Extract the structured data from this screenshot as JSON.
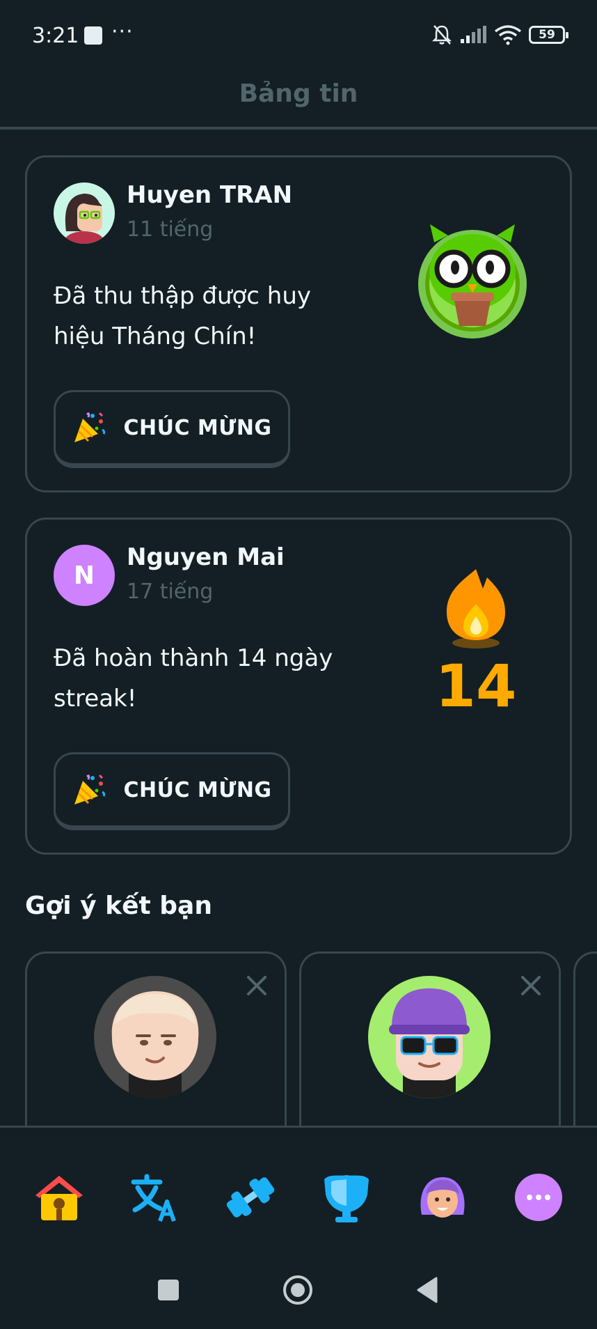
{
  "status_bar": {
    "time": "3:21",
    "dots": "···",
    "battery": "59",
    "icons": [
      "notification-square-icon",
      "bell-off-icon",
      "signal-icon",
      "wifi-icon",
      "battery-icon"
    ]
  },
  "header": {
    "title": "Bảng tin"
  },
  "feed": [
    {
      "name": "Huyen TRAN",
      "time": "11 tiếng",
      "message": "Đã thu thập được huy hiệu Tháng Chín!",
      "button": "CHÚC MỪNG",
      "art": "monthly-badge-owl-icon"
    },
    {
      "name": "Nguyen Mai",
      "avatar_letter": "N",
      "time": "17 tiếng",
      "message": "Đã hoàn thành 14 ngày streak!",
      "button": "CHÚC MỪNG",
      "art": "streak-flame-icon",
      "streak": "14"
    }
  ],
  "suggestions": {
    "title": "Gợi ý kết bạn",
    "items": [
      {
        "avatar": "avatar-pale-icon",
        "close": "×"
      },
      {
        "avatar": "avatar-purple-cap-icon",
        "close": "×"
      }
    ]
  },
  "bottom_nav": {
    "items": [
      "home-icon",
      "translate-icon",
      "dumbbell-icon",
      "shield-icon",
      "profile-icon",
      "more-icon"
    ]
  },
  "system_nav": {
    "items": [
      "recents-icon",
      "home-circle-icon",
      "back-icon"
    ]
  },
  "colors": {
    "background": "#131f24",
    "border": "#37464f",
    "muted_text": "#52656d",
    "streak_orange": "#ffaa00",
    "purple": "#ce82ff",
    "blue": "#1cb0f6"
  }
}
